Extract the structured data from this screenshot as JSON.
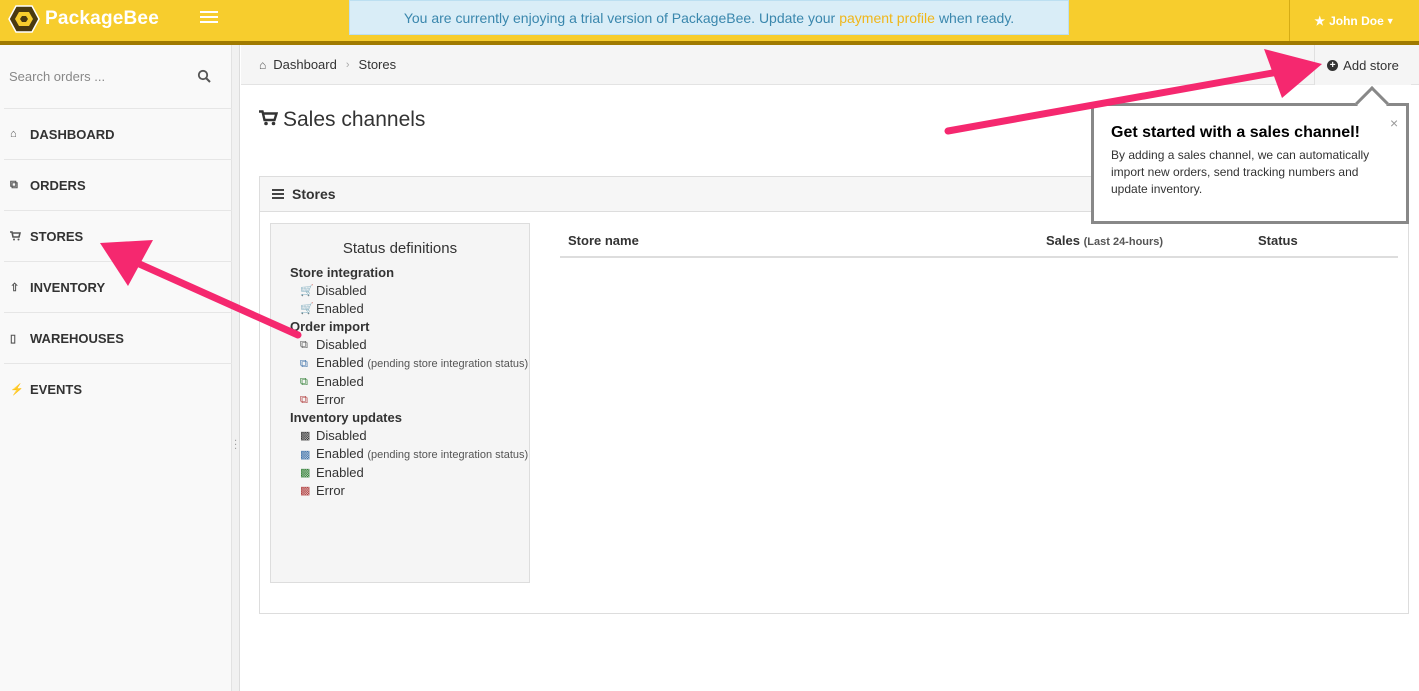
{
  "app": {
    "name": "PackageBee"
  },
  "trial": {
    "before": "You are currently enjoying a trial version of PackageBee. Update your",
    "link": "payment profile",
    "after": "when ready."
  },
  "user": {
    "name": "John Doe"
  },
  "search": {
    "placeholder": "Search orders ..."
  },
  "sidebar": {
    "items": [
      {
        "label": "DASHBOARD",
        "icon": "home-icon"
      },
      {
        "label": "ORDERS",
        "icon": "orders-icon"
      },
      {
        "label": "STORES",
        "icon": "cart-icon"
      },
      {
        "label": "INVENTORY",
        "icon": "upload-icon"
      },
      {
        "label": "WAREHOUSES",
        "icon": "warehouse-icon"
      },
      {
        "label": "EVENTS",
        "icon": "bolt-icon"
      }
    ]
  },
  "breadcrumb": {
    "home": "Dashboard",
    "current": "Stores"
  },
  "add_store": "Add store",
  "page_title": "Sales channels",
  "panel": {
    "title": "Stores"
  },
  "definitions": {
    "title": "Status definitions",
    "store_integration": {
      "title": "Store integration",
      "disabled": "Disabled",
      "enabled": "Enabled"
    },
    "order_import": {
      "title": "Order import",
      "disabled": "Disabled",
      "enabled_pending": "Enabled",
      "pending_note": "(pending store integration status)",
      "enabled": "Enabled",
      "error": "Error"
    },
    "inventory_updates": {
      "title": "Inventory updates",
      "disabled": "Disabled",
      "enabled_pending": "Enabled",
      "pending_note": "(pending store integration status)",
      "enabled": "Enabled",
      "error": "Error"
    }
  },
  "table": {
    "store_name": "Store name",
    "sales": "Sales",
    "sales_note": "(Last 24-hours)",
    "status": "Status"
  },
  "popover": {
    "title": "Get started with a sales channel!",
    "body": "By adding a sales channel, we can automatically import new orders, send tracking numbers and update inventory.",
    "close": "×"
  },
  "colors": {
    "brand": "#f7cd2d",
    "arrow": "#f5286f",
    "enabled": "#2e7d32",
    "pending": "#3a6fa8",
    "error": "#b03a3a"
  }
}
